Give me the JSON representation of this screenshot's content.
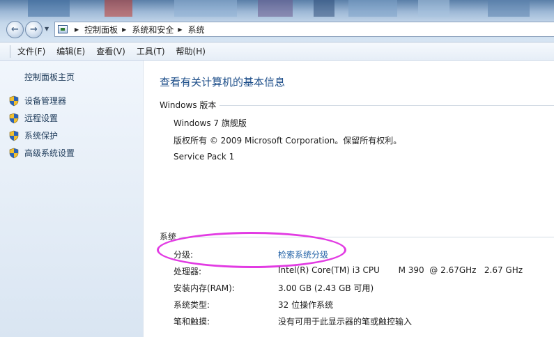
{
  "address_bar": {
    "breadcrumbs": [
      "控制面板",
      "系统和安全",
      "系统"
    ]
  },
  "menu": {
    "items": [
      "文件(F)",
      "编辑(E)",
      "查看(V)",
      "工具(T)",
      "帮助(H)"
    ]
  },
  "sidebar": {
    "home_label": "控制面板主页",
    "links": [
      {
        "label": "设备管理器",
        "icon": "shield-icon"
      },
      {
        "label": "远程设置",
        "icon": "shield-icon"
      },
      {
        "label": "系统保护",
        "icon": "shield-icon"
      },
      {
        "label": "高级系统设置",
        "icon": "shield-icon"
      }
    ]
  },
  "main": {
    "title": "查看有关计算机的基本信息",
    "windows_section": {
      "header": "Windows 版本",
      "edition": "Windows 7 旗舰版",
      "copyright": "版权所有 © 2009 Microsoft Corporation。保留所有权利。",
      "service_pack": "Service Pack 1"
    },
    "system_section": {
      "header": "系统",
      "rows": [
        {
          "label": "分级:",
          "value": "检索系统分级"
        },
        {
          "label": "处理器:",
          "value": "Intel(R) Core(TM) i3 CPU       M 390  @ 2.67GHz   2.67 GHz"
        },
        {
          "label": "安装内存(RAM):",
          "value": "3.00 GB (2.43 GB 可用)"
        },
        {
          "label": "系统类型:",
          "value": "32 位操作系统"
        },
        {
          "label": "笔和触摸:",
          "value": "没有可用于此显示器的笔或触控输入"
        }
      ]
    }
  },
  "colors": {
    "title_blue": "#1e4f8a",
    "link_blue": "#1f5fa5",
    "highlight_magenta": "#e23be3"
  }
}
